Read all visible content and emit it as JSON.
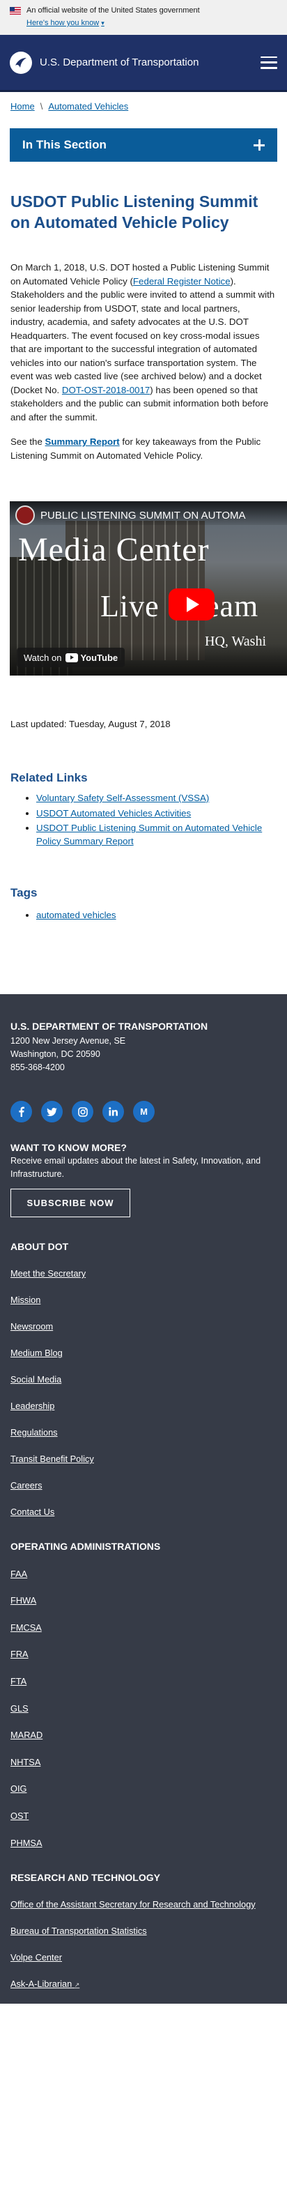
{
  "gov_banner": {
    "official_text": "An official website of the United States government",
    "how_you_know": "Here's how you know"
  },
  "header": {
    "title": "U.S. Department of Transportation"
  },
  "breadcrumb": {
    "home": "Home",
    "separator": "\\",
    "current": "Automated Vehicles"
  },
  "in_section": {
    "label": "In This Section"
  },
  "page": {
    "title": "USDOT Public Listening Summit on Automated Vehicle Policy",
    "p1_a": "On March 1, 2018, U.S. DOT hosted a Public Listening Summit on Automated Vehicle Policy (",
    "p1_link1": "Federal Register Notice",
    "p1_b": "). Stakeholders and the public were invited to attend a summit with senior leadership from USDOT, state and local partners, industry, academia, and safety advocates at the U.S. DOT Headquarters.  The event focused on key cross-modal issues that are important to the successful integration of automated vehicles into our nation's surface transportation system.  The event was web casted live (see archived below) and a docket (Docket No. ",
    "p1_link2": "DOT-OST-2018-0017",
    "p1_c": ") has been opened so that stakeholders and the public can submit information both before and after the summit.",
    "p2_a": "See the ",
    "p2_link": "Summary Report",
    "p2_b": " for key takeaways from the Public Listening Summit on Automated Vehicle Policy.",
    "last_updated": "Last updated: Tuesday, August 7, 2018"
  },
  "video": {
    "title": "PUBLIC LISTENING SUMMIT ON AUTOMA",
    "overlay_line1": "Media Center",
    "overlay_line2": "Live Stream",
    "overlay_line3": "HQ, Washi",
    "watch_on": "Watch on",
    "youtube": "YouTube"
  },
  "related": {
    "heading": "Related Links",
    "links": [
      "Voluntary Safety Self-Assessment (VSSA)",
      "USDOT Automated Vehicles Activities",
      "USDOT Public Listening Summit on Automated Vehicle Policy Summary Report"
    ]
  },
  "tags": {
    "heading": "Tags",
    "items": [
      "automated vehicles"
    ]
  },
  "footer": {
    "org": "U.S. DEPARTMENT OF TRANSPORTATION",
    "address1": "1200 New Jersey Avenue, SE",
    "address2": "Washington, DC 20590",
    "phone": "855-368-4200",
    "social": [
      "f",
      "t",
      "ig",
      "in",
      "M"
    ],
    "want_heading": "WANT TO KNOW MORE?",
    "want_desc": "Receive email updates about the latest in Safety, Innovation, and Infrastructure.",
    "subscribe": "SUBSCRIBE NOW",
    "about_heading": "ABOUT DOT",
    "about_links": [
      "Meet the Secretary",
      "Mission",
      "Newsroom",
      "Medium Blog",
      "Social Media",
      "Leadership",
      "Regulations",
      "Transit Benefit Policy",
      "Careers",
      "Contact Us"
    ],
    "ops_heading": "OPERATING ADMINISTRATIONS",
    "ops_links": [
      "FAA",
      "FHWA",
      "FMCSA",
      "FRA",
      "FTA",
      "GLS",
      "MARAD",
      "NHTSA",
      "OIG",
      "OST",
      "PHMSA"
    ],
    "research_heading": "RESEARCH AND TECHNOLOGY",
    "research_links": [
      "Office of the Assistant Secretary for Research and Technology",
      "Bureau of Transportation Statistics",
      "Volpe Center",
      "Ask-A-Librarian"
    ]
  }
}
